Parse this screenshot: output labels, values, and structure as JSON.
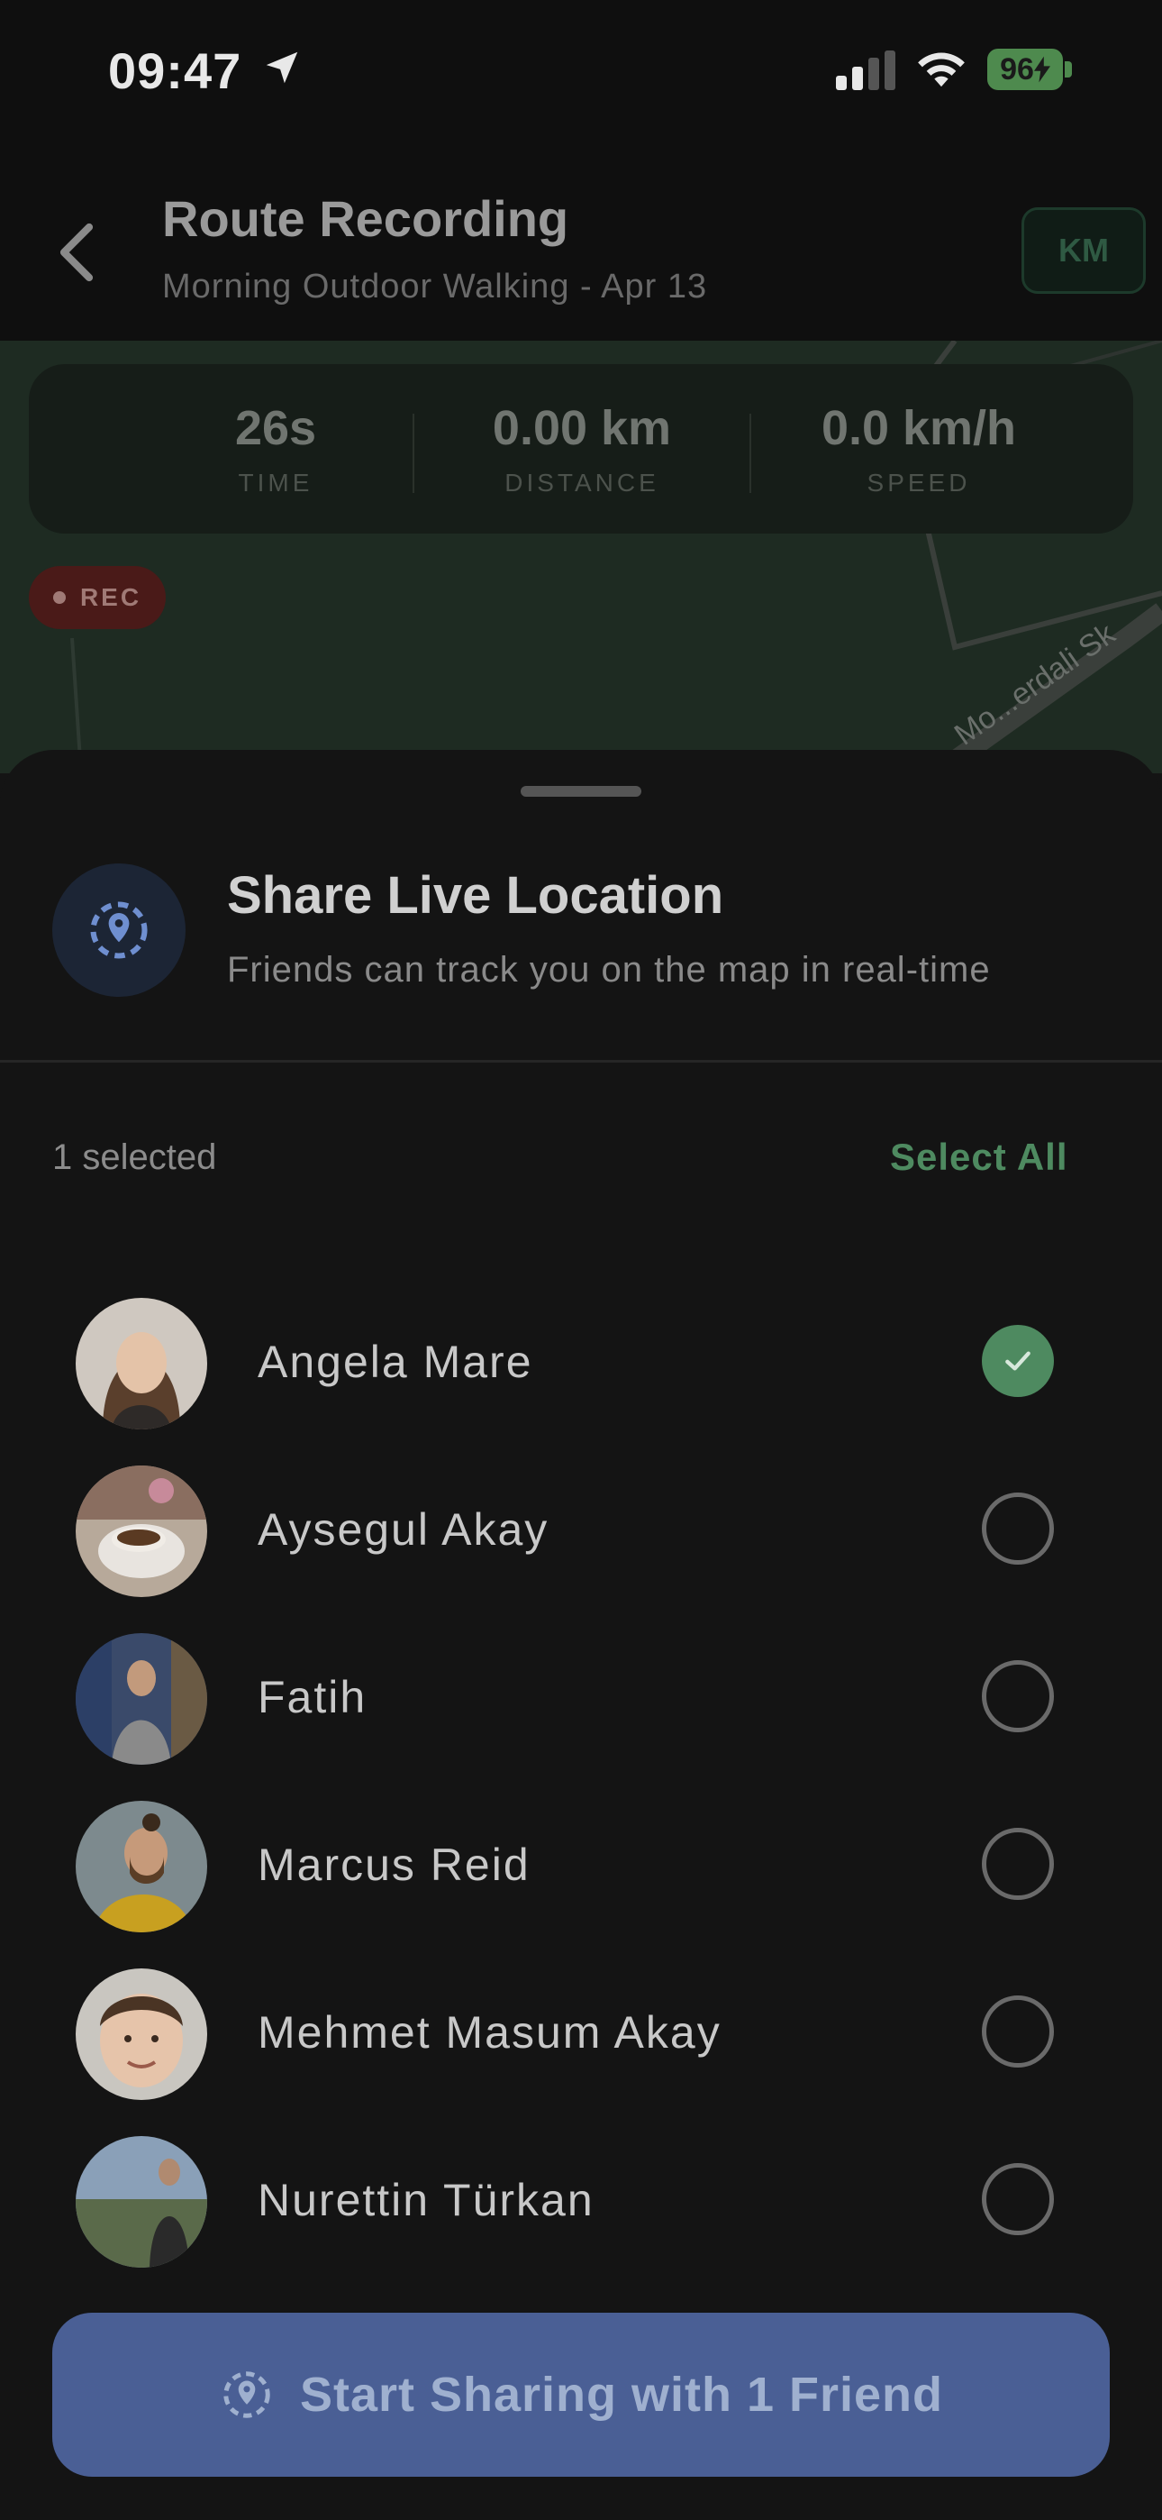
{
  "status_bar": {
    "time": "09:47",
    "battery": "96"
  },
  "header": {
    "title": "Route Recording",
    "subtitle": "Morning Outdoor Walking - Apr 13",
    "unit_button": "KM"
  },
  "stats": [
    {
      "value": "26s",
      "label": "TIME"
    },
    {
      "value": "0.00 km",
      "label": "DISTANCE"
    },
    {
      "value": "0.0 km/h",
      "label": "SPEED"
    }
  ],
  "recording_badge": "REC",
  "map": {
    "street_label": "Mo...erdali Sk"
  },
  "sheet": {
    "title": "Share Live Location",
    "subtitle": "Friends can track you on the map in real-time",
    "selected_count": "1 selected",
    "select_all": "Select All",
    "friends": [
      {
        "name": "Angela Mare",
        "selected": true
      },
      {
        "name": "Aysegul Akay",
        "selected": false
      },
      {
        "name": "Fatih",
        "selected": false
      },
      {
        "name": "Marcus Reid",
        "selected": false
      },
      {
        "name": "Mehmet Masum Akay",
        "selected": false
      },
      {
        "name": "Nurettin Türkan",
        "selected": false
      }
    ],
    "cta": "Start Sharing with 1 Friend"
  },
  "colors": {
    "accent_green": "#4e8a60",
    "cta_blue": "#4a5f95",
    "rec_red": "#4a1a18"
  }
}
